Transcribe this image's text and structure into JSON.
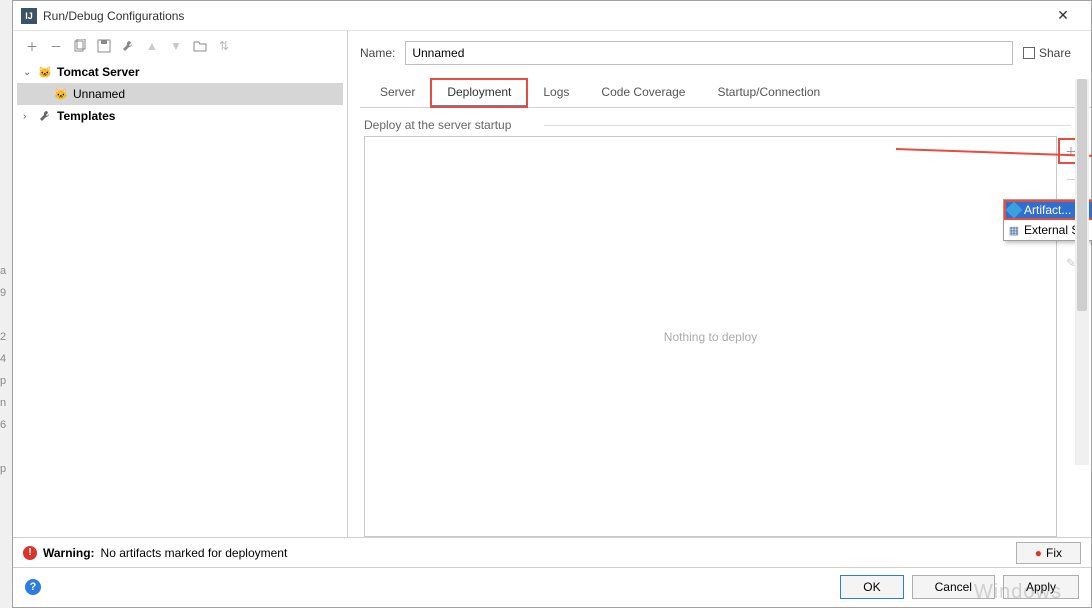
{
  "window": {
    "title": "Run/Debug Configurations"
  },
  "sidebar": {
    "items": [
      {
        "label": "Tomcat Server",
        "expanded": true
      },
      {
        "label": "Unnamed",
        "selected": true
      },
      {
        "label": "Templates",
        "expanded": false
      }
    ]
  },
  "form": {
    "name_label": "Name:",
    "name_value": "Unnamed",
    "share_label": "Share"
  },
  "tabs": [
    {
      "label": "Server"
    },
    {
      "label": "Deployment",
      "active": true
    },
    {
      "label": "Logs"
    },
    {
      "label": "Code Coverage"
    },
    {
      "label": "Startup/Connection"
    }
  ],
  "deployment": {
    "section_label": "Deploy at the server startup",
    "empty_text": "Nothing to deploy"
  },
  "popup": {
    "artifact": "Artifact...",
    "external": "External S"
  },
  "warning": {
    "label": "Warning:",
    "text": "No artifacts marked for deployment",
    "fix": "Fix"
  },
  "buttons": {
    "ok": "OK",
    "cancel": "Cancel",
    "apply": "Apply"
  },
  "watermark": "Windows"
}
